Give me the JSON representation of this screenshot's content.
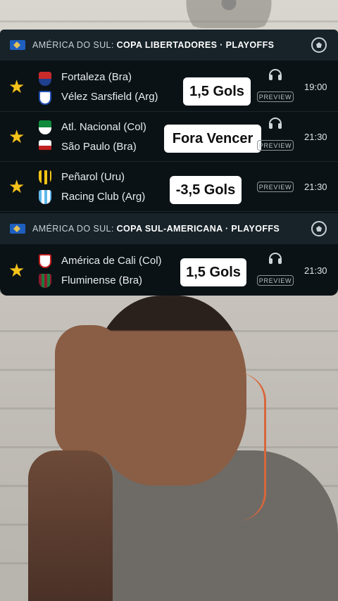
{
  "leagues": [
    {
      "region": "AMÉRICA DO SUL:",
      "name": "COPA LIBERTADORES · PLAYOFFS",
      "matches": [
        {
          "home": "Fortaleza (Bra)",
          "away": "Vélez Sarsfield (Arg)",
          "time": "19:00",
          "preview": "PREVIEW",
          "bet": "1,5 Gols"
        },
        {
          "home": "Atl. Nacional (Col)",
          "away": "São Paulo (Bra)",
          "time": "21:30",
          "preview": "PREVIEW",
          "bet": "Fora Vencer"
        },
        {
          "home": "Peñarol (Uru)",
          "away": "Racing Club (Arg)",
          "time": "21:30",
          "preview": "PREVIEW",
          "bet": "-3,5 Gols"
        }
      ]
    },
    {
      "region": "AMÉRICA DO SUL:",
      "name": "COPA SUL-AMERICANA · PLAYOFFS",
      "matches": [
        {
          "home": "América de Cali (Col)",
          "away": "Fluminense (Bra)",
          "time": "21:30",
          "preview": "PREVIEW",
          "bet": "1,5 Gols"
        }
      ]
    }
  ],
  "colors": {
    "panel_bg": "#0b1216",
    "header_bg": "#172329",
    "star": "#f4c21a",
    "bet_bg": "#ffffff"
  },
  "icons": [
    "star-icon",
    "headphones-icon",
    "soccer-ball-icon",
    "flag-icon",
    "team-crest-icon"
  ]
}
